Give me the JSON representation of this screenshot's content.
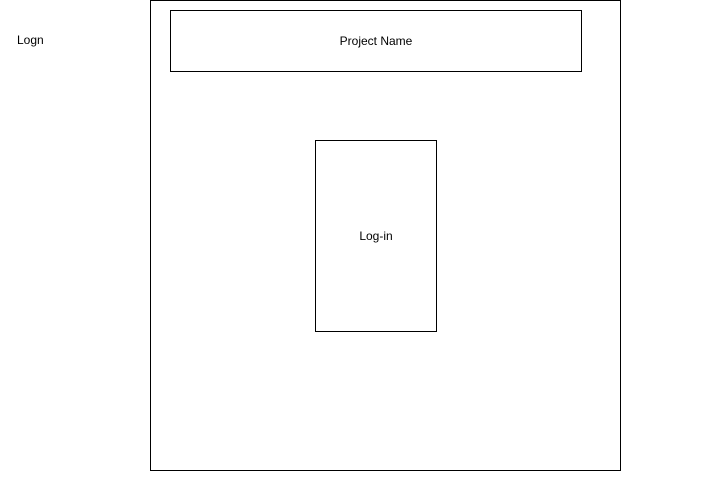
{
  "page_label": "Logn",
  "header": {
    "title": "Project Name"
  },
  "login_panel": {
    "label": "Log-in"
  }
}
